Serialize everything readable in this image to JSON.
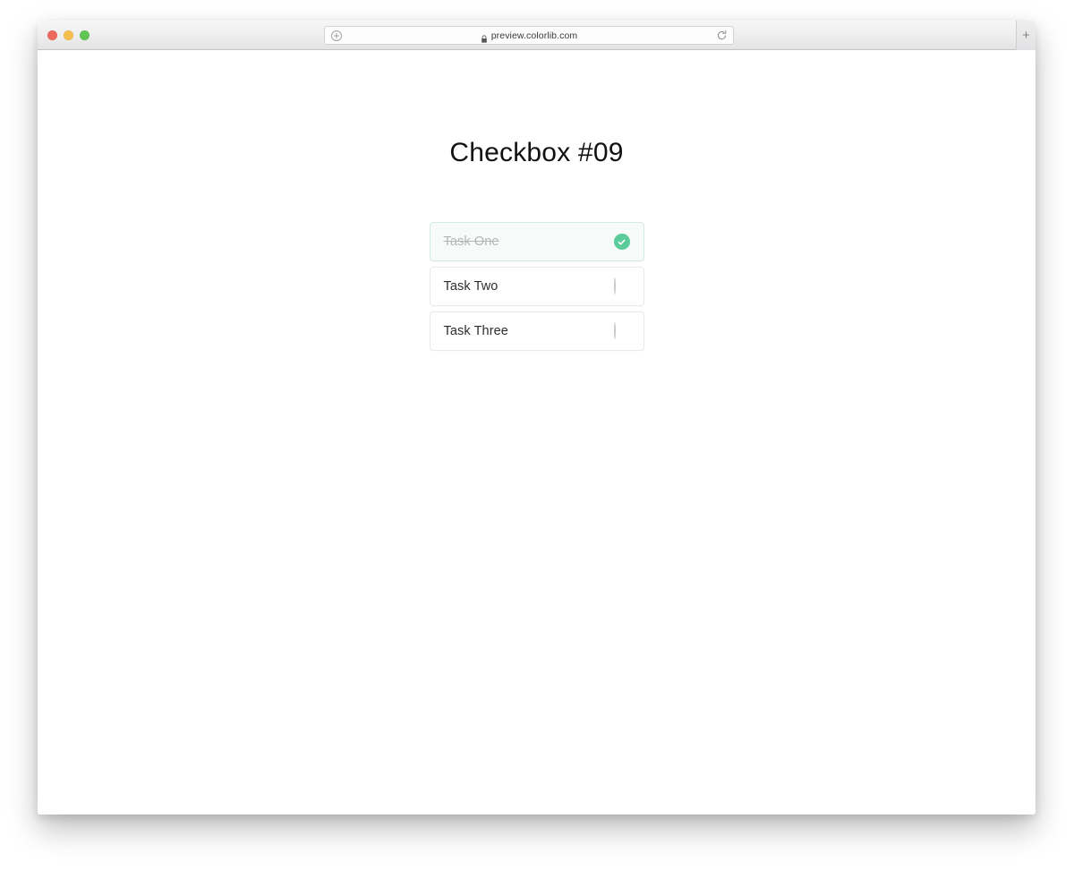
{
  "browser": {
    "traffic_lights": [
      {
        "name": "close",
        "color": "#ee6a5f"
      },
      {
        "name": "minimize",
        "color": "#f5bf4f"
      },
      {
        "name": "maximize",
        "color": "#61c554"
      }
    ],
    "address_bar": {
      "url": "preview.colorlib.com",
      "lock_icon": "lock-icon",
      "left_icon": "add-site-icon",
      "reload_icon": "reload-icon"
    },
    "new_tab": {
      "label": "+",
      "icon": "plus-icon"
    }
  },
  "page": {
    "title": "Checkbox #09",
    "accent_color": "#5bcc99",
    "tasks": [
      {
        "label": "Task One",
        "checked": true,
        "indicator_icon": "check-circle-filled-icon"
      },
      {
        "label": "Task Two",
        "checked": false,
        "indicator_icon": "circle-outline-icon"
      },
      {
        "label": "Task Three",
        "checked": false,
        "indicator_icon": "circle-outline-icon"
      }
    ]
  }
}
